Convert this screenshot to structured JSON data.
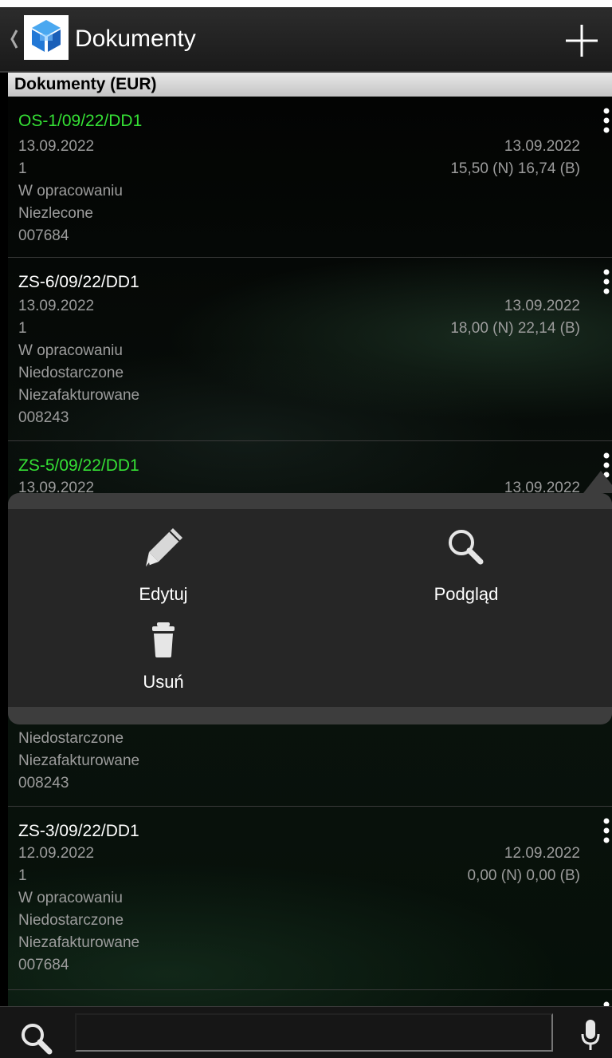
{
  "app_bar": {
    "title": "Dokumenty"
  },
  "section": {
    "title": "Dokumenty (EUR)"
  },
  "documents": [
    {
      "number": "OS-1/09/22/DD1",
      "highlight": true,
      "date": "13.09.2022",
      "date_right": "13.09.2022",
      "qty": "1",
      "amounts": "15,50 (N) 16,74 (B)",
      "lines": [
        "W opracowaniu",
        "Niezlecone",
        "007684"
      ]
    },
    {
      "number": "ZS-6/09/22/DD1",
      "highlight": false,
      "date": "13.09.2022",
      "date_right": "13.09.2022",
      "qty": "1",
      "amounts": "18,00 (N) 22,14 (B)",
      "lines": [
        "W opracowaniu",
        "Niedostarczone",
        "Niezafakturowane",
        "008243"
      ]
    },
    {
      "number": "ZS-5/09/22/DD1",
      "highlight": true,
      "date": "13.09.2022",
      "date_right": "13.09.2022",
      "lines_after_menu": [
        "Niedostarczone",
        "Niezafakturowane",
        "008243"
      ]
    },
    {
      "number": "ZS-3/09/22/DD1",
      "highlight": false,
      "date": "12.09.2022",
      "date_right": "12.09.2022",
      "qty": "1",
      "amounts": "0,00 (N) 0,00 (B)",
      "lines": [
        "W opracowaniu",
        "Niedostarczone",
        "Niezafakturowane",
        "007684"
      ]
    }
  ],
  "context_menu": {
    "edit_label": "Edytuj",
    "preview_label": "Podgląd",
    "delete_label": "Usuń"
  },
  "search": {
    "placeholder": ""
  },
  "colors": {
    "highlight_green": "#35e035",
    "secondary_text": "#9c9c9c",
    "header_bg": "#d6d6d6"
  }
}
